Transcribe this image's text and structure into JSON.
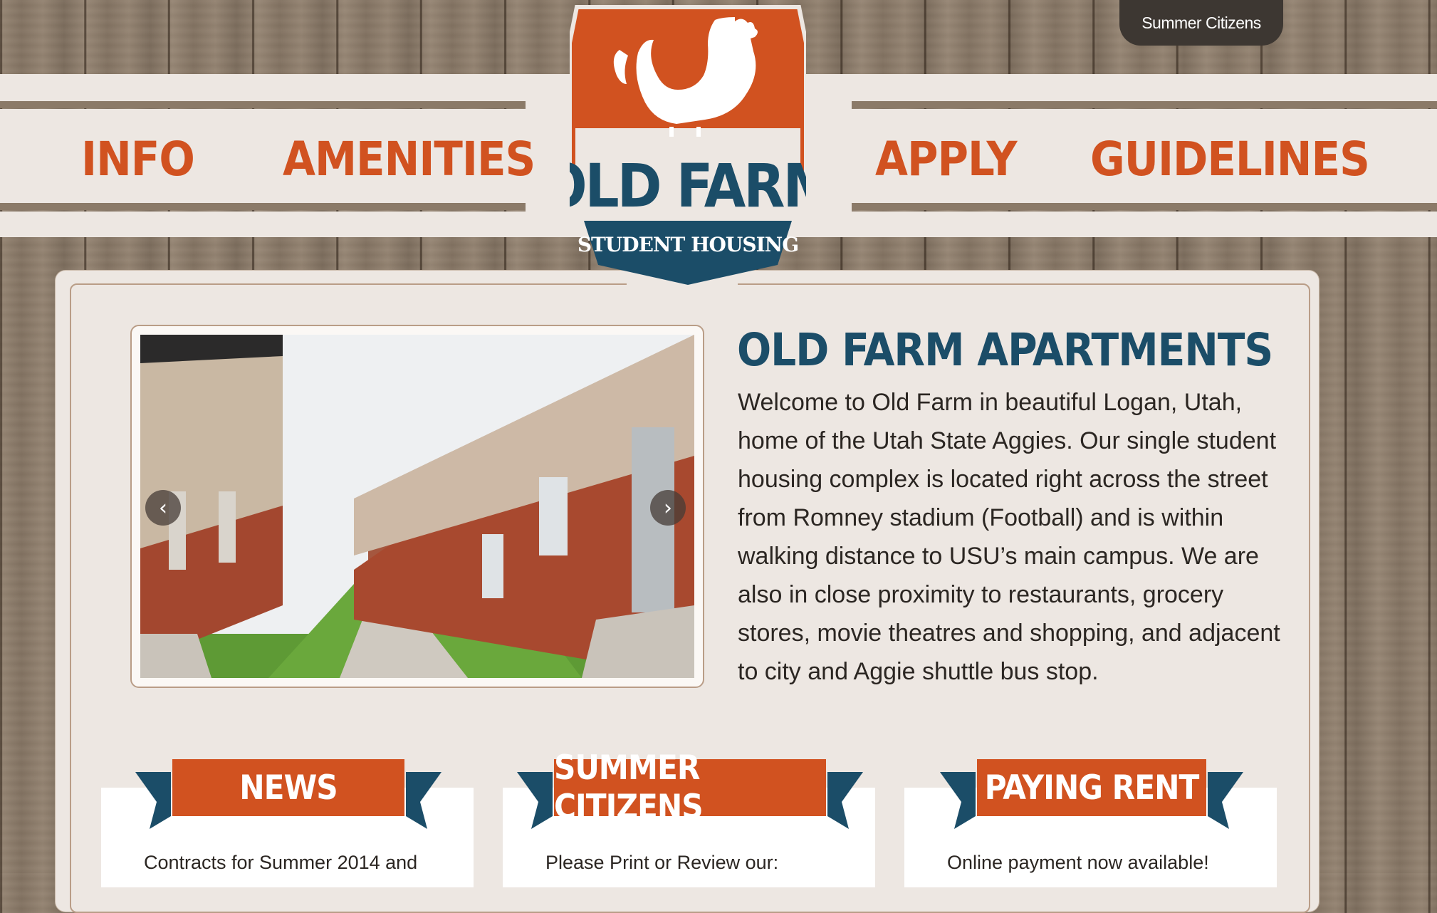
{
  "top_tab": {
    "label": "Summer Citizens"
  },
  "nav": {
    "left": [
      {
        "label": "INFO"
      },
      {
        "label": "AMENITIES"
      }
    ],
    "right": [
      {
        "label": "APPLY"
      },
      {
        "label": "GUIDELINES"
      }
    ]
  },
  "logo": {
    "name": "OLD FARM",
    "tagline": "STUDENT HOUSING"
  },
  "slider": {
    "prev_icon": "chevron-left-icon",
    "next_icon": "chevron-right-icon"
  },
  "intro": {
    "title": "OLD FARM APARTMENTS",
    "text": "Welcome to Old Farm in beautiful Logan, Utah, home of the Utah State Aggies. Our single student housing complex is located right across the street from Romney stadium (Football) and is within walking distance to USU’s main campus. We are also in close proximity to restaurants, grocery stores, movie theatres and shopping, and adjacent to city and Aggie shuttle bus stop."
  },
  "cards": [
    {
      "title": "NEWS",
      "text": "Contracts for Summer 2014 and"
    },
    {
      "title": "SUMMER CITIZENS",
      "text": "Please Print or Review our:"
    },
    {
      "title": "PAYING RENT",
      "text": "Online payment now available!"
    }
  ],
  "colors": {
    "orange": "#d15220",
    "navy": "#1b4d68",
    "cream": "#ede7e2"
  }
}
